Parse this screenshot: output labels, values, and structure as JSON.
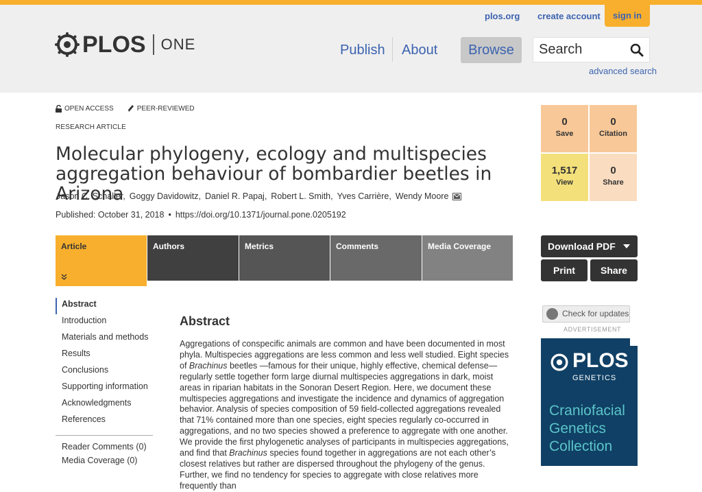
{
  "header": {
    "links": {
      "plos_org": "plos.org",
      "create_account": "create account",
      "sign_in": "sign in"
    },
    "logo": {
      "name": "PLOS",
      "journal": "ONE"
    },
    "nav": {
      "publish": "Publish",
      "about": "About",
      "browse": "Browse"
    },
    "search": {
      "placeholder": "Search",
      "advanced": "advanced search"
    }
  },
  "article": {
    "badges": {
      "open_access": "OPEN ACCESS",
      "peer_reviewed": "PEER-REVIEWED"
    },
    "type": "RESEARCH ARTICLE",
    "title": "Molecular phylogeny, ecology and multispecies aggregation behaviour of bombardier beetles in Arizona",
    "authors": [
      "Jason C. Schaller,",
      "Goggy Davidowitz,",
      "Daniel R. Papaj,",
      "Robert L. Smith,",
      "Yves Carrière,",
      "Wendy Moore"
    ],
    "published": "Published: October 31, 2018",
    "doi": "https://doi.org/10.1371/journal.pone.0205192"
  },
  "metrics": {
    "save": {
      "value": "0",
      "label": "Save"
    },
    "citation": {
      "value": "0",
      "label": "Citation"
    },
    "view": {
      "value": "1,517",
      "label": "View"
    },
    "share": {
      "value": "0",
      "label": "Share"
    }
  },
  "tabs": [
    "Article",
    "Authors",
    "Metrics",
    "Comments",
    "Media Coverage"
  ],
  "actions": {
    "download_pdf": "Download PDF",
    "print": "Print",
    "share": "Share"
  },
  "sidenav": {
    "items": [
      "Abstract",
      "Introduction",
      "Materials and methods",
      "Results",
      "Conclusions",
      "Supporting information",
      "Acknowledgments",
      "References"
    ],
    "reader_comments": "Reader Comments (0)",
    "media_coverage": "Media Coverage (0)"
  },
  "abstract": {
    "heading": "Abstract",
    "p1": "Aggregations of conspecific animals are common and have been documented in most phyla. Multispecies aggregations are less common and less well studied. Eight species of ",
    "genus": "Brachinus",
    "p2": " beetles —famous for their unique, highly effective, chemical defense—regularly settle together form large diurnal multispecies aggregations in dark, moist areas in riparian habitats in the Sonoran Desert Region. Here, we document these multispecies aggregations and investigate the incidence and dynamics of aggregation behavior. Analysis of species composition of 59 field-collected aggregations revealed that 71% contained more than one species, eight species regularly co-occurred in aggregations, and no two species showed a preference to aggregate with one another. We provide the first phylogenetic analyses of participants in multispecies aggregations, and find that ",
    "p3": " species found together in aggregations are not each other’s closest relatives but rather are dispersed throughout the phylogeny of the genus. Further, we find no tendency for species to aggregate with close relatives more frequently than"
  },
  "sidebar": {
    "check_updates": "Check for updates",
    "advertisement": "ADVERTISEMENT",
    "ad": {
      "brand": "PLOS",
      "sub": "GENETICS",
      "headline": "Craniofacial Genetics Collection"
    }
  },
  "colors": {
    "accent": "#f8af2d",
    "link": "#3c63af",
    "ad_bg": "#104065",
    "ad_text": "#5bc4c9"
  }
}
